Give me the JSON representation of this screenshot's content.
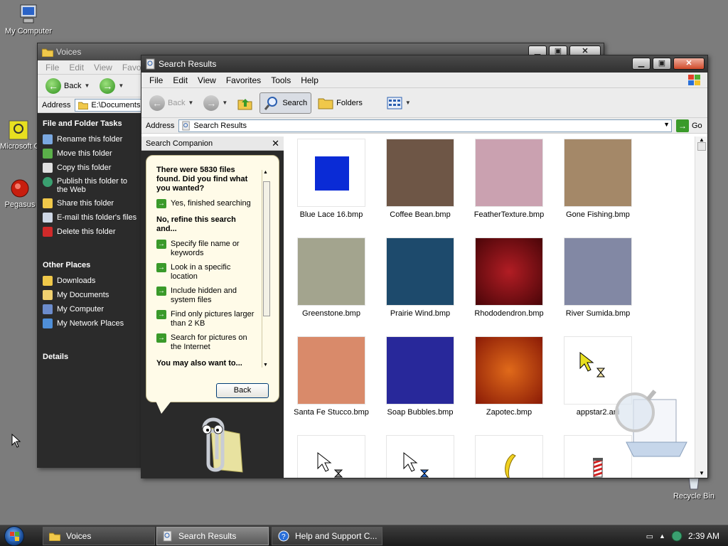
{
  "desktop": {
    "icons": [
      {
        "label": "My Computer"
      },
      {
        "label": "Microsoft Outlook"
      },
      {
        "label": "Pegasus"
      },
      {
        "label": "Recycle Bin"
      }
    ]
  },
  "voices_window": {
    "title": "Voices",
    "menu": [
      "File",
      "Edit",
      "View",
      "Favorites"
    ],
    "toolbar": {
      "back_label": "Back"
    },
    "address_label": "Address",
    "address_value": "E:\\Documents",
    "tasks_header": "File and Folder Tasks",
    "tasks": [
      "Rename this folder",
      "Move this folder",
      "Copy this folder",
      "Publish this folder to the Web",
      "Share this folder",
      "E-mail this folder's files",
      "Delete this folder"
    ],
    "other_places_header": "Other Places",
    "other_places": [
      "Downloads",
      "My Documents",
      "My Computer",
      "My Network Places"
    ],
    "details_header": "Details"
  },
  "search_window": {
    "title": "Search Results",
    "menu": [
      "File",
      "Edit",
      "View",
      "Favorites",
      "Tools",
      "Help"
    ],
    "toolbar": {
      "back_label": "Back",
      "search_label": "Search",
      "folders_label": "Folders"
    },
    "address_label": "Address",
    "address_value": "Search Results",
    "go_label": "Go",
    "companion": {
      "header": "Search Companion",
      "message": "There were 5830 files found. Did you find what you wanted?",
      "yes_option": "Yes, finished searching",
      "refine_header": "No, refine this search and...",
      "options": [
        "Specify file name or keywords",
        "Look in a specific location",
        "Include hidden and system files",
        "Find only pictures larger than 2 KB",
        "Search for pictures on the Internet"
      ],
      "also_header": "You may also want to...",
      "back_button": "Back"
    },
    "files": [
      {
        "name": "Blue Lace 16.bmp",
        "color": "#0a2bd6"
      },
      {
        "name": "Coffee Bean.bmp",
        "color": "#6e5646"
      },
      {
        "name": "FeatherTexture.bmp",
        "color": "#caa1b0"
      },
      {
        "name": "Gone Fishing.bmp",
        "color": "#a48868"
      },
      {
        "name": "Greenstone.bmp",
        "color": "#a3a48e"
      },
      {
        "name": "Prairie Wind.bmp",
        "color": "#1d4a6c"
      },
      {
        "name": "Rhododendron.bmp",
        "color": "#7d0f14"
      },
      {
        "name": "River Sumida.bmp",
        "color": "#8288a4"
      },
      {
        "name": "Santa Fe Stucco.bmp",
        "color": "#d98a6a"
      },
      {
        "name": "Soap Bubbles.bmp",
        "color": "#28289a"
      },
      {
        "name": "Zapotec.bmp",
        "color": "#c04a0e"
      },
      {
        "name": "appstar2.ani",
        "color": "#ffffff"
      }
    ]
  },
  "taskbar": {
    "tasks": [
      "Voices",
      "Search Results",
      "Help and Support C..."
    ],
    "clock": "2:39 AM"
  },
  "colors": {
    "accent_green": "#3a9a2a",
    "titlebar": "#3a3a3a"
  }
}
